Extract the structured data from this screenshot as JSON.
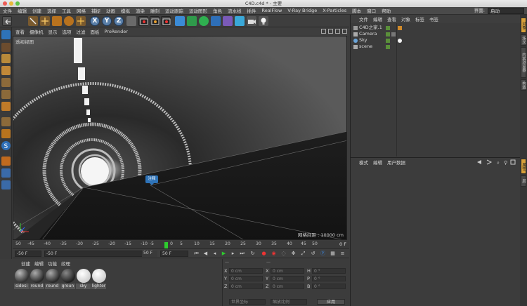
{
  "window": {
    "title": "C4D.c4d * - 主要"
  },
  "menubar": {
    "items": [
      "文件",
      "编辑",
      "创建",
      "选择",
      "工具",
      "网格",
      "捕捉",
      "动画",
      "模拟",
      "渲染",
      "雕刻",
      "运动跟踪",
      "运动图形",
      "角色",
      "流水线",
      "插件",
      "RealFlow",
      "V-Ray Bridge",
      "X-Particles",
      "脚本",
      "窗口",
      "帮助"
    ],
    "layout_label": "界面:",
    "layout_value": "启动"
  },
  "viewport": {
    "menu": [
      "查看",
      "摄像机",
      "显示",
      "选项",
      "过滤",
      "面板",
      "ProRender"
    ],
    "label": "透视视图",
    "grid_label": "网格间距 : 10000 cm",
    "annotation": "注释"
  },
  "timeline": {
    "ticks": [
      "50",
      "-45",
      "-40",
      "-35",
      "-30",
      "-25",
      "-20",
      "-15",
      "-10",
      "-5",
      "0",
      "5",
      "10",
      "15",
      "20",
      "25",
      "30",
      "35",
      "40",
      "45",
      "50"
    ],
    "frame_readout": "0 F",
    "start_field": "-50 F",
    "current_field": "-50 F",
    "end_field_a": "50 F",
    "end_field_b": "50 F"
  },
  "materials": {
    "menu": [
      "创建",
      "编辑",
      "功能",
      "纹理"
    ],
    "items": [
      {
        "name": "sidesi"
      },
      {
        "name": "round"
      },
      {
        "name": "round"
      },
      {
        "name": "groun"
      },
      {
        "name": "sky"
      },
      {
        "name": "lighter"
      }
    ]
  },
  "coordinates": {
    "header_symbols": [
      "—",
      "—"
    ],
    "rows": [
      {
        "axis": "X",
        "pos": "0 cm",
        "axis2": "X",
        "size": "0 cm",
        "axis3": "H",
        "rot": "0 °"
      },
      {
        "axis": "Y",
        "pos": "0 cm",
        "axis2": "Y",
        "size": "0 cm",
        "axis3": "P",
        "rot": "0 °"
      },
      {
        "axis": "Z",
        "pos": "0 cm",
        "axis2": "Z",
        "size": "0 cm",
        "axis3": "B",
        "rot": "0 °"
      }
    ],
    "mode_world": "世界坐标",
    "mode_scale": "缩放比例",
    "apply": "应用"
  },
  "object_manager": {
    "menu": [
      "文件",
      "编辑",
      "查看",
      "对象",
      "标签",
      "书签"
    ],
    "objects": [
      {
        "name": "C4D之家.1"
      },
      {
        "name": "Camera"
      },
      {
        "name": "Sky"
      },
      {
        "name": "scene"
      }
    ]
  },
  "attributes": {
    "menu": [
      "模式",
      "编辑",
      "用户数据"
    ]
  },
  "side_tabs": [
    "对象",
    "场次",
    "内容浏览器",
    "构造",
    "属性",
    "层"
  ],
  "colors": {
    "accent_orange": "#d9a13a",
    "playhead_green": "#2ecc2e",
    "annotation_blue": "#2e73b8"
  }
}
